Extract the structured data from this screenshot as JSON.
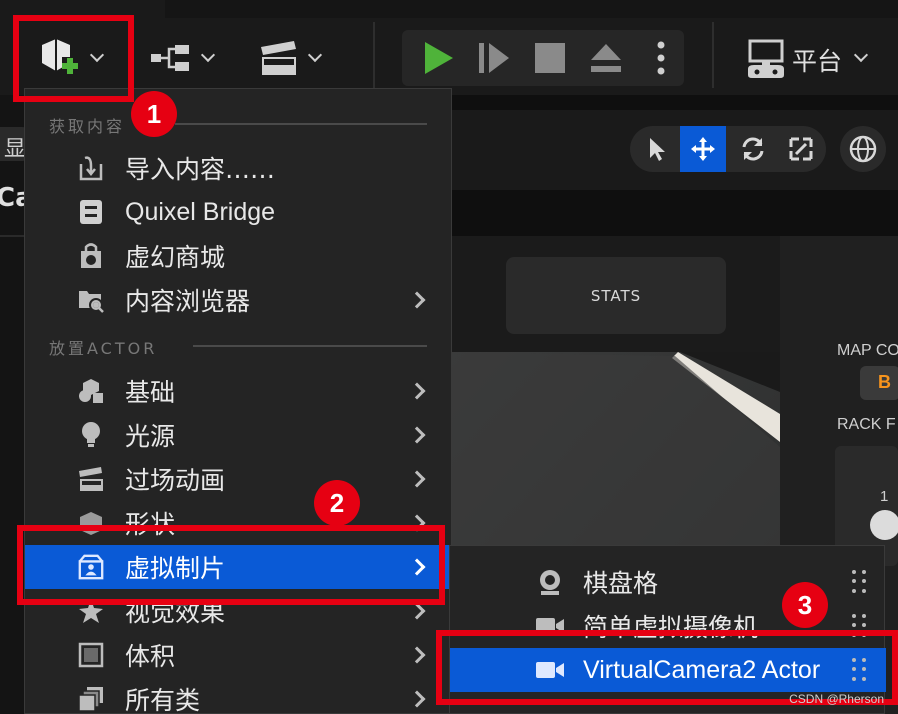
{
  "toolbar": {
    "platform_label": "平台"
  },
  "left_clipped": {
    "text_1": "显",
    "text_2": "Ca"
  },
  "viewport": {
    "stats_label": "STATS",
    "map_label": "MAP CO",
    "badge_letter": "B",
    "rack_label": "RACK F",
    "slider_value": "1"
  },
  "menu": {
    "section_get_content": "获取内容",
    "section_place_actor": "放置ACTOR",
    "items_get": [
      {
        "label": "导入内容……",
        "icon": "import-icon",
        "submenu": false
      },
      {
        "label": "Quixel Bridge",
        "icon": "quixel-bridge-icon",
        "submenu": false
      },
      {
        "label": "虚幻商城",
        "icon": "marketplace-icon",
        "submenu": false
      },
      {
        "label": "内容浏览器",
        "icon": "content-browser-icon",
        "submenu": true
      }
    ],
    "items_place": [
      {
        "label": "基础",
        "icon": "basic-shapes-icon",
        "submenu": true
      },
      {
        "label": "光源",
        "icon": "light-bulb-icon",
        "submenu": true
      },
      {
        "label": "过场动画",
        "icon": "clapperboard-icon",
        "submenu": true
      },
      {
        "label": "形状",
        "icon": "cube-icon",
        "submenu": true
      },
      {
        "label": "虚拟制片",
        "icon": "virtual-production-icon",
        "submenu": true,
        "active": true
      },
      {
        "label": "视觉效果",
        "icon": "visual-effects-icon",
        "submenu": true
      },
      {
        "label": "体积",
        "icon": "volume-icon",
        "submenu": true
      },
      {
        "label": "所有类",
        "icon": "all-classes-icon",
        "submenu": true
      }
    ]
  },
  "submenu": {
    "items": [
      {
        "label": "棋盘格",
        "icon": "checkerboard-icon"
      },
      {
        "label": "简单虚拟摄像机",
        "icon": "video-camera-icon"
      },
      {
        "label": "VirtualCamera2 Actor",
        "icon": "video-camera-icon",
        "active": true
      }
    ]
  },
  "annotations": {
    "step_1": "1",
    "step_2": "2",
    "step_3": "3",
    "highlight_color": "#e60012"
  },
  "colors": {
    "accent_blue": "#0a5ad6",
    "play_green": "#4fb33a"
  },
  "watermark": "CSDN @Rherson"
}
